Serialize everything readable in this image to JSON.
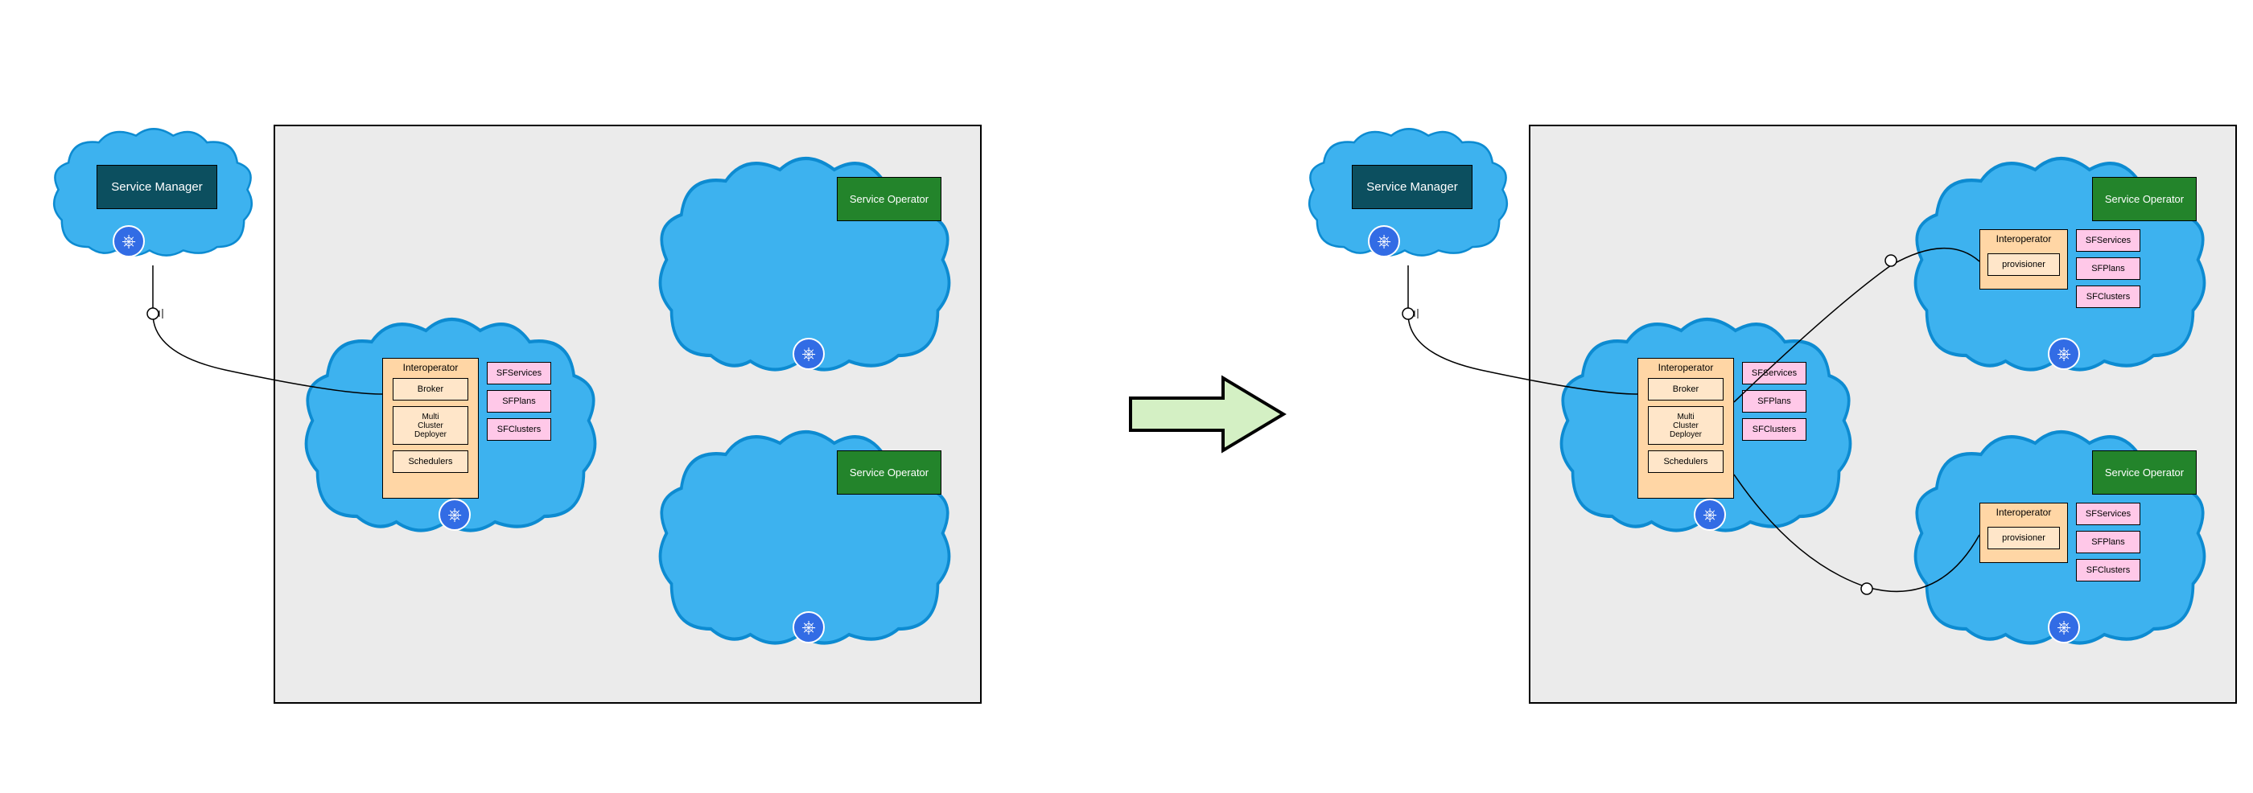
{
  "labels": {
    "service_manager": "Service Manager",
    "service_operator": "Service Operator",
    "interoperator": "Interoperator",
    "broker": "Broker",
    "multi_cluster_deployer": "Multi\nCluster\nDeployer",
    "schedulers": "Schedulers",
    "provisioner": "provisioner",
    "sfservices": "SFServices",
    "sfplans": "SFPlans",
    "sfclusters": "SFClusters"
  },
  "colors": {
    "cloud_fill": "#3db2ef",
    "cloud_stroke": "#0d8bd1",
    "panel_bg": "#ebebeb",
    "dark_teal": "#0c4f5f",
    "green": "#23842b",
    "orange": "#ffd6a5",
    "orange_inner": "#ffe6c9",
    "pink": "#ffc8e8",
    "arrow_fill": "#d4f0c4"
  },
  "chart_data": {
    "type": "diagram",
    "title": "Interoperator multi-cluster deployment: before and after",
    "arrow_direction": "left-to-right",
    "before": {
      "external_cluster": {
        "components": [
          "Service Manager"
        ],
        "connects_to": "panel.main_cluster.Interoperator"
      },
      "panel": {
        "main_cluster": {
          "Interoperator": {
            "subcomponents": [
              "Broker",
              "Multi Cluster Deployer",
              "Schedulers"
            ]
          },
          "resources": [
            "SFServices",
            "SFPlans",
            "SFClusters"
          ]
        },
        "worker_clusters": [
          {
            "components": [
              "Service Operator"
            ]
          },
          {
            "components": [
              "Service Operator"
            ]
          }
        ]
      }
    },
    "after": {
      "external_cluster": {
        "components": [
          "Service Manager"
        ],
        "connects_to": "panel.main_cluster.Interoperator"
      },
      "panel": {
        "main_cluster": {
          "Interoperator": {
            "subcomponents": [
              "Broker",
              "Multi Cluster Deployer",
              "Schedulers"
            ]
          },
          "resources": [
            "SFServices",
            "SFPlans",
            "SFClusters"
          ],
          "connects_to": [
            "worker_clusters.0.Interoperator",
            "worker_clusters.1.Interoperator"
          ]
        },
        "worker_clusters": [
          {
            "components": [
              "Service Operator"
            ],
            "Interoperator": {
              "subcomponents": [
                "provisioner"
              ]
            },
            "resources": [
              "SFServices",
              "SFPlans",
              "SFClusters"
            ]
          },
          {
            "components": [
              "Service Operator"
            ],
            "Interoperator": {
              "subcomponents": [
                "provisioner"
              ]
            },
            "resources": [
              "SFServices",
              "SFPlans",
              "SFClusters"
            ]
          }
        ]
      }
    }
  }
}
